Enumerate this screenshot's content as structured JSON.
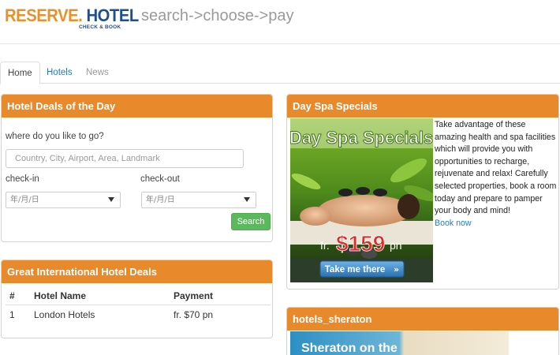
{
  "header": {
    "logo_reserve": "RESERVE.",
    "logo_hotel": "HOTEL",
    "logo_sub": "CHECK & BOOK",
    "tagline": "search->choose->pay"
  },
  "tabs": [
    {
      "label": "Home",
      "active": true
    },
    {
      "label": "Hotels",
      "active": false
    },
    {
      "label": "News",
      "active": false
    }
  ],
  "deals": {
    "title": "Hotel Deals of the Day",
    "question": "where do you like to go?",
    "destination_placeholder": "Country, City, Airport, Area, Landmark",
    "checkin_label": "check-in",
    "checkout_label": "check-out",
    "checkin_value": "年/月/日",
    "checkout_value": "年/月/日",
    "search_label": "Search"
  },
  "international": {
    "title": "Great International Hotel Deals",
    "columns": [
      "#",
      "Hotel Name",
      "Payment"
    ],
    "rows": [
      {
        "num": "1",
        "name": "London Hotels",
        "payment": "fr. $70 pn"
      }
    ]
  },
  "spa": {
    "title": "Day Spa Specials",
    "image_title": "Day Spa Specials",
    "image_price_prefix": "fr.",
    "image_price": "$159",
    "image_price_suffix": "pn",
    "image_button": "Take me there",
    "description": "Take advantage of these amazing health and spa facilities which will provide you with opportunities to recharge, rejuvenate and relax! Carefully selected properties, book a room today and prepare to pamper your body and mind!",
    "link": "Book now"
  },
  "sheraton": {
    "title": "hotels_sheraton",
    "image_title": "Sheraton on the"
  },
  "colors": {
    "panel_header": "#e8892c",
    "logo_orange": "#e8912c",
    "logo_blue": "#1e4f8f",
    "link": "#2a7ab8",
    "search_button": "#5cb85c"
  }
}
